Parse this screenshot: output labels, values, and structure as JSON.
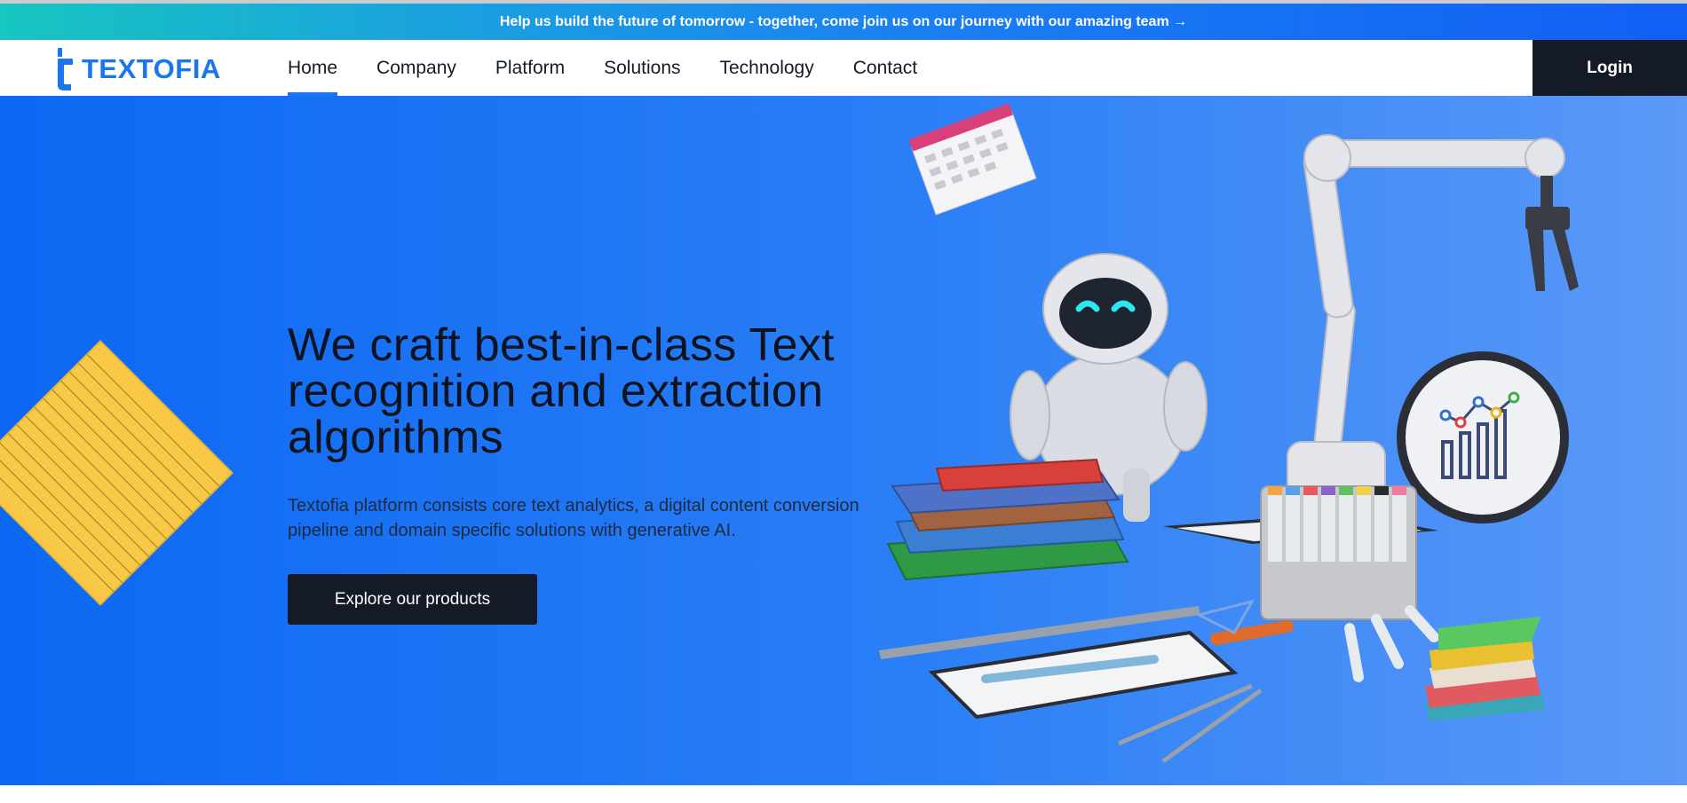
{
  "banner": {
    "text": "Help us build the future of tomorrow - together, come join us on our journey with our amazing team →"
  },
  "header": {
    "logo_text": "TEXTOFIA",
    "nav": [
      {
        "label": "Home",
        "active": true
      },
      {
        "label": "Company"
      },
      {
        "label": "Platform"
      },
      {
        "label": "Solutions"
      },
      {
        "label": "Technology"
      },
      {
        "label": "Contact"
      }
    ],
    "login_label": "Login"
  },
  "hero": {
    "headline": "We craft best-in-class Text recognition and extraction algorithms",
    "subtext": "Textofia platform consists core text analytics, a digital content conversion pipeline and domain specific solutions with generative AI.",
    "cta_label": "Explore our products"
  },
  "colors": {
    "brand": "#1976ee",
    "dark": "#151b26",
    "hero_start": "#0c68f3",
    "hero_end": "#5b99f7",
    "banner_start": "#17c6c0",
    "banner_end": "#125ff5"
  },
  "icons": [
    "textofia-logo-icon",
    "notepad-decoration",
    "robot-illustration",
    "calendar-illustration"
  ]
}
